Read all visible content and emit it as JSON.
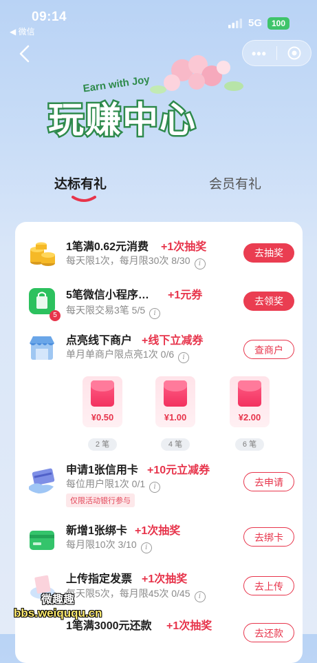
{
  "status_bar": {
    "time": "09:14",
    "back_app": "◀ 微信",
    "network": "5G",
    "battery": "100"
  },
  "banner": {
    "subtitle": "Earn with Joy",
    "title": "玩赚中心"
  },
  "tabs": [
    {
      "label": "达标有礼",
      "active": true
    },
    {
      "label": "会员有礼",
      "active": false
    }
  ],
  "tasks": [
    {
      "title": "1笔满0.62元消费",
      "reward": "+1次抽奖",
      "desc": "每天限1次，每月限30次  8/30",
      "button": "去抽奖"
    },
    {
      "title": "5笔微信小程序…",
      "reward": "+1元券",
      "desc": "每天限交易3笔  5/5",
      "badge": "5",
      "button": "去领奖"
    },
    {
      "title": "点亮线下商户",
      "reward": "+线下立减券",
      "desc": "单月单商户限点亮1次  0/6",
      "button": "查商户"
    },
    {
      "title": "申请1张信用卡",
      "reward": "+10元立减券",
      "desc": "每位用户限1次  0/1",
      "tag": "仅限活动银行参与",
      "button": "去申请"
    },
    {
      "title": "新增1张绑卡",
      "reward": "+1次抽奖",
      "desc": "每月限10次  3/10",
      "button": "去绑卡"
    },
    {
      "title": "上传指定发票",
      "reward": "+1次抽奖",
      "desc": "每天限5次，每月限45次  0/45",
      "button": "去上传"
    },
    {
      "title": "1笔满3000元还款",
      "reward": "+1次抽奖",
      "button": "去还款"
    }
  ],
  "red_packets": [
    {
      "amount": "¥0.50",
      "label": "2 笔"
    },
    {
      "amount": "¥1.00",
      "label": "4 笔"
    },
    {
      "amount": "¥2.00",
      "label": "6 笔"
    }
  ],
  "watermark": {
    "text": "bbs.weiququ.cn",
    "brand": "微趣趣"
  },
  "colors": {
    "accent": "#e7344b",
    "background": "#c9ddf7"
  }
}
